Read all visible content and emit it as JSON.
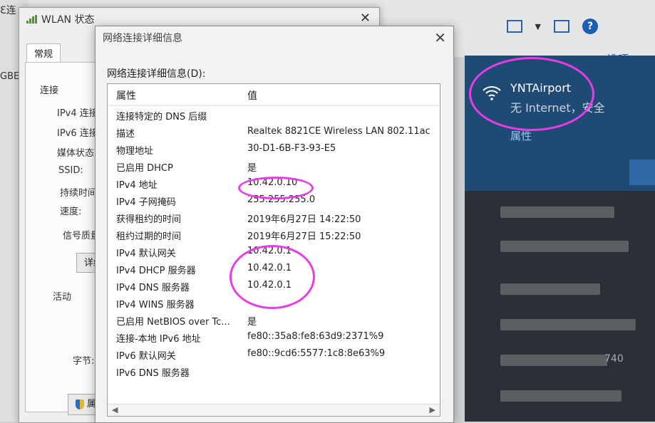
{
  "background": {
    "top_left_text": "Ɛ连",
    "left_text": "GBE",
    "options_link": "选项"
  },
  "wlan_window": {
    "title": "WLAN 状态",
    "tab": "常规",
    "connection_label": "连接",
    "rows": [
      "IPv4 连接",
      "IPv6 连接",
      "媒体状态",
      "SSID:",
      "持续时间",
      "速度:"
    ],
    "signal_quality": "信号质量",
    "details_button": "详细",
    "activity": "活动",
    "bytes": "字节:",
    "properties_button": "属性(I"
  },
  "details_dialog": {
    "title": "网络连接详细信息",
    "label": "网络连接详细信息(D):",
    "columns": {
      "property": "属性",
      "value": "值"
    },
    "rows": [
      {
        "property": "连接特定的 DNS 后缀",
        "value": ""
      },
      {
        "property": "描述",
        "value": "Realtek 8821CE Wireless LAN 802.11ac"
      },
      {
        "property": "物理地址",
        "value": "30-D1-6B-F3-93-E5"
      },
      {
        "property": "已启用 DHCP",
        "value": "是"
      },
      {
        "property": "IPv4 地址",
        "value": "10.42.0.10"
      },
      {
        "property": "IPv4 子网掩码",
        "value": "255.255.255.0"
      },
      {
        "property": "获得租约的时间",
        "value": "2019年6月27日 14:22:50"
      },
      {
        "property": "租约过期的时间",
        "value": "2019年6月27日 15:22:50"
      },
      {
        "property": "IPv4 默认网关",
        "value": "10.42.0.1"
      },
      {
        "property": "IPv4 DHCP 服务器",
        "value": "10.42.0.1"
      },
      {
        "property": "IPv4 DNS 服务器",
        "value": "10.42.0.1"
      },
      {
        "property": "IPv4 WINS 服务器",
        "value": ""
      },
      {
        "property": "已启用 NetBIOS over Tc...",
        "value": "是"
      },
      {
        "property": "连接-本地 IPv6 地址",
        "value": "fe80::35a8:fe8:63d9:2371%9"
      },
      {
        "property": "IPv6 默认网关",
        "value": "fe80::9cd6:5577:1c8:8e63%9"
      },
      {
        "property": "IPv6 DNS 服务器",
        "value": ""
      }
    ]
  },
  "flyout": {
    "ssid": "YNTAirport",
    "status": "无 Internet，安全",
    "properties_link": "属性",
    "blurred_text": "740"
  }
}
